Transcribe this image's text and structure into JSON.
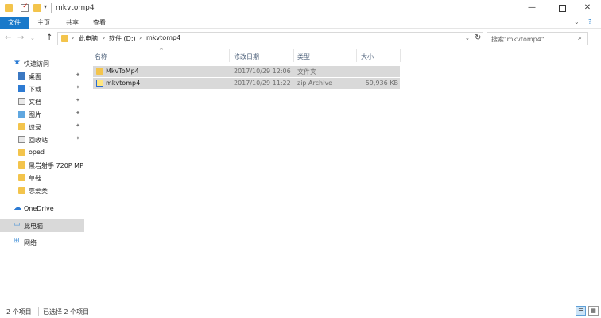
{
  "window": {
    "title": "mkvtomp4",
    "minimize": "—",
    "maximize": "",
    "close": "✕",
    "dropdown_glyph": "▾"
  },
  "ribbon": {
    "tabs": [
      "文件",
      "主页",
      "共享",
      "查看"
    ],
    "expand_glyph": "⌄",
    "help_glyph": "?"
  },
  "nav": {
    "back": "←",
    "forward": "→",
    "recent": "⌄",
    "up": "↑"
  },
  "address": {
    "crumbs": [
      "此电脑",
      "软件 (D:)",
      "mkvtomp4"
    ],
    "separator": "›",
    "dropdown": "⌄",
    "refresh": "↻"
  },
  "search": {
    "placeholder": "搜索\"mkvtomp4\"",
    "icon": "⌕"
  },
  "sidebar": {
    "quick_access": "快速访问",
    "items": [
      {
        "label": "桌面",
        "pinned": true
      },
      {
        "label": "下载",
        "pinned": true
      },
      {
        "label": "文档",
        "pinned": true
      },
      {
        "label": "图片",
        "pinned": true
      },
      {
        "label": "识录",
        "pinned": true
      },
      {
        "label": "回收站",
        "pinned": true
      },
      {
        "label": "oped",
        "pinned": false
      },
      {
        "label": "黑岩射手 720P MP",
        "pinned": false
      },
      {
        "label": "草鞋",
        "pinned": false
      },
      {
        "label": "恋爱类",
        "pinned": false
      }
    ],
    "pin_glyph": "✦",
    "onedrive": "OneDrive",
    "this_pc": "此电脑",
    "network": "网络"
  },
  "list": {
    "sort_glyph": "^",
    "columns": [
      "名称",
      "修改日期",
      "类型",
      "大小"
    ],
    "rows": [
      {
        "name": "MkvToMp4",
        "date": "2017/10/29 12:06",
        "type": "文件夹",
        "size": ""
      },
      {
        "name": "mkvtomp4",
        "date": "2017/10/29 11:22",
        "type": "zip Archive",
        "size": "59,936 KB"
      }
    ]
  },
  "status": {
    "count": "2 个项目",
    "selected": "已选择 2 个项目",
    "view_details": "☰",
    "view_icons": "▦"
  },
  "colors": {
    "accent": "#1979ca",
    "selection": "#d9d9d9",
    "folder": "#f3c44c"
  }
}
